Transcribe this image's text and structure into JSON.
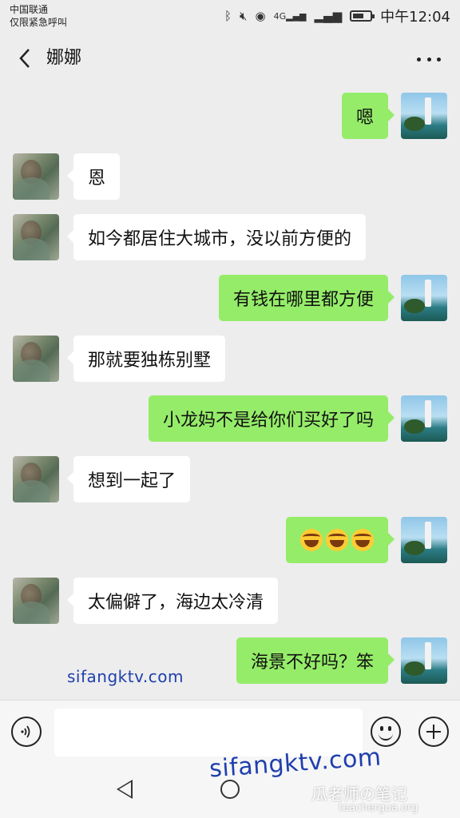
{
  "status_bar": {
    "carrier_line1": "中国联通",
    "carrier_line2": "仅限紧急呼叫",
    "icons": [
      "bluetooth-icon",
      "mute-icon",
      "eye-icon",
      "signal-4g-icon",
      "signal-x-icon",
      "battery-icon"
    ],
    "network_label": "4G",
    "time": "中午12:04"
  },
  "header": {
    "title": "娜娜"
  },
  "messages": [
    {
      "side": "me",
      "text": "嗯"
    },
    {
      "side": "her",
      "text": "恩"
    },
    {
      "side": "her",
      "text": "如今都居住大城市，没以前方便的"
    },
    {
      "side": "me",
      "text": "有钱在哪里都方便"
    },
    {
      "side": "her",
      "text": "那就要独栋别墅"
    },
    {
      "side": "me",
      "text": "小龙妈不是给你们买好了吗"
    },
    {
      "side": "her",
      "text": "想到一起了"
    },
    {
      "side": "me",
      "text": "",
      "emoji": [
        "face-with-tears-of-joy-icon",
        "face-with-tears-of-joy-icon",
        "face-with-tears-of-joy-icon"
      ]
    },
    {
      "side": "her",
      "text": "太偏僻了，海边太冷清"
    },
    {
      "side": "me",
      "text": "海景不好吗？笨"
    }
  ],
  "watermarks": {
    "site_small": "sifangktv.com",
    "site_large": "sifangktv.com",
    "brand": "瓜老师の笔记",
    "brand_url": "teachergua.org"
  },
  "colors": {
    "outgoing_bubble": "#95ec69",
    "incoming_bubble": "#ffffff",
    "background": "#ededed"
  }
}
